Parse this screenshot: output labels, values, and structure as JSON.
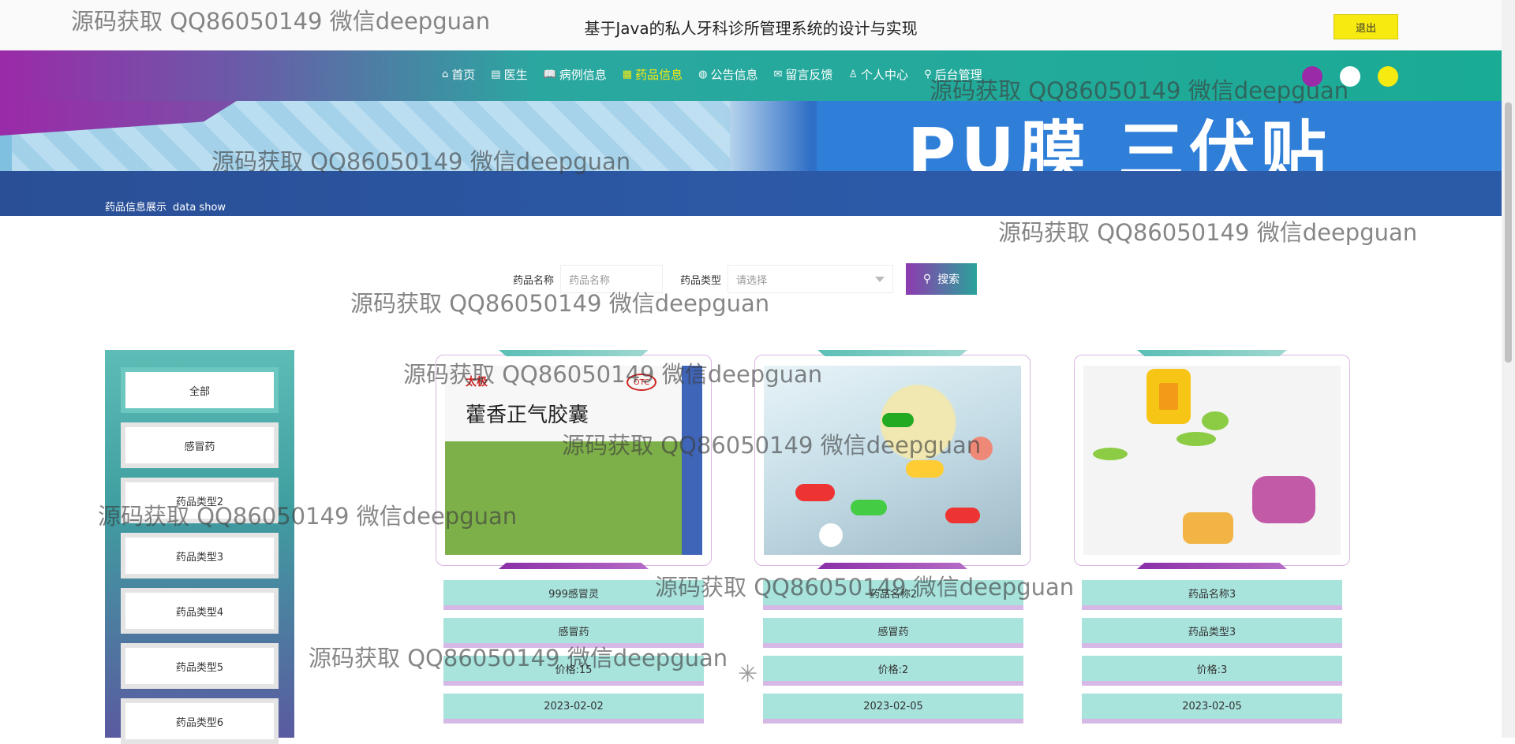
{
  "header": {
    "title": "基于Java的私人牙科诊所管理系统的设计与实现",
    "logout_label": "退出"
  },
  "banner": {
    "text": "PU膜 三伏贴"
  },
  "nav": {
    "items": [
      {
        "icon": "⌂",
        "icon_name": "home-icon",
        "label": "首页"
      },
      {
        "icon": "▤",
        "icon_name": "doctor-icon",
        "label": "医生"
      },
      {
        "icon": "📖",
        "icon_name": "book-icon",
        "label": "病例信息"
      },
      {
        "icon": "▦",
        "icon_name": "medicine-icon",
        "label": "药品信息",
        "active": true
      },
      {
        "icon": "◍",
        "icon_name": "globe-icon",
        "label": "公告信息"
      },
      {
        "icon": "✉",
        "icon_name": "mail-icon",
        "label": "留言反馈"
      },
      {
        "icon": "♙",
        "icon_name": "user-icon",
        "label": "个人中心"
      },
      {
        "icon": "⚲",
        "icon_name": "admin-icon",
        "label": "后台管理"
      }
    ],
    "theme_colors": [
      "#9b2aa8",
      "#ffffff",
      "#f7ea10"
    ]
  },
  "section": {
    "title": "药品信息展示",
    "subtitle": "data show"
  },
  "search": {
    "name_label": "药品名称",
    "name_placeholder": "药品名称",
    "type_label": "药品类型",
    "type_placeholder": "请选择",
    "button_label": "搜索"
  },
  "categories": [
    "全部",
    "感冒药",
    "药品类型2",
    "药品类型3",
    "药品类型4",
    "药品类型5",
    "药品类型6"
  ],
  "products": [
    {
      "name": "999感冒灵",
      "type": "感冒药",
      "price": "价格:15",
      "date": "2023-02-02",
      "image_text": "藿香正气胶囊",
      "image_brand": "太极",
      "image_otc": "OTC"
    },
    {
      "name": "药品名称2",
      "type": "感冒药",
      "price": "价格:2",
      "date": "2023-02-05"
    },
    {
      "name": "药品名称3",
      "type": "药品类型3",
      "price": "价格:3",
      "date": "2023-02-05"
    }
  ],
  "watermark": "源码获取 QQ86050149 微信deepguan",
  "colors": {
    "accent_teal": "#1aab94",
    "accent_purple": "#9b2aa8",
    "active_nav": "#f7ea10",
    "logout_bg": "#f7ea10"
  }
}
